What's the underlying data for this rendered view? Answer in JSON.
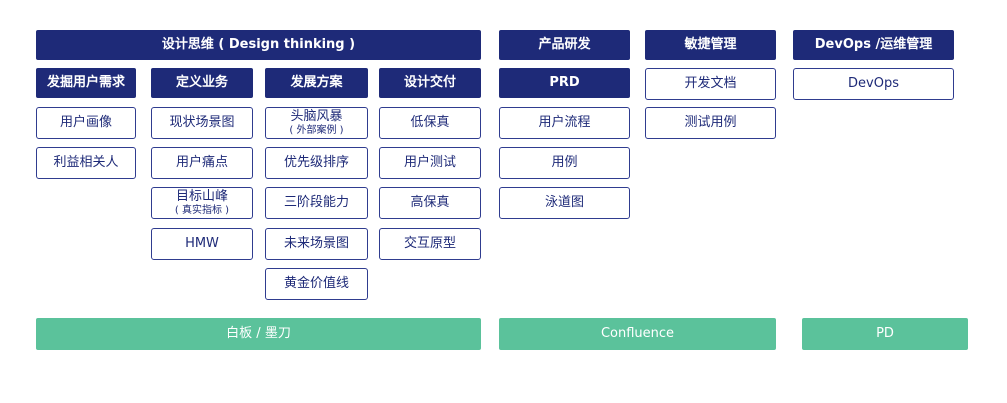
{
  "headers": {
    "design_thinking": "设计思维 ( Design thinking )",
    "product_rd": "产品研发",
    "agile": "敏捷管理",
    "devops": "DevOps /运维管理"
  },
  "subheaders": {
    "discover": "发掘用户需求",
    "define": "定义业务",
    "develop": "发展方案",
    "deliver": "设计交付",
    "prd": "PRD"
  },
  "col_discover": [
    "用户画像",
    "利益相关人"
  ],
  "col_define": [
    {
      "title": "现状场景图"
    },
    {
      "title": "用户痛点"
    },
    {
      "title": "目标山峰",
      "sub": "( 真实指标 )"
    },
    {
      "title": "HMW"
    }
  ],
  "col_develop": [
    {
      "title": "头脑风暴",
      "sub": "( 外部案例 )"
    },
    {
      "title": "优先级排序"
    },
    {
      "title": "三阶段能力"
    },
    {
      "title": "未来场景图"
    },
    {
      "title": "黄金价值线"
    }
  ],
  "col_deliver": [
    "低保真",
    "用户测试",
    "高保真",
    "交互原型"
  ],
  "col_prd": [
    "用户流程",
    "用例",
    "泳道图"
  ],
  "col_agile": [
    "开发文档",
    "测试用例"
  ],
  "col_devops": [
    "DevOps"
  ],
  "tools": {
    "whiteboard": "白板 / 墨刀",
    "confluence": "Confluence",
    "pd": "PD"
  },
  "colors": {
    "navy": "#1e2a78",
    "green": "#5bc29b",
    "border": "#2f3c8f"
  }
}
